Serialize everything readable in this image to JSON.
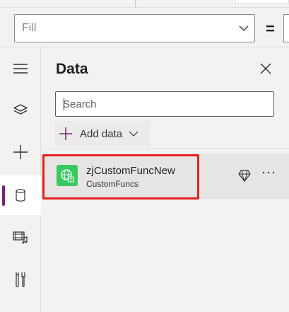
{
  "property_bar": {
    "property_value": "Fill",
    "equals": "="
  },
  "rail": {
    "items": [
      {
        "icon": "hamburger-menu-icon"
      },
      {
        "icon": "layers-icon"
      },
      {
        "icon": "plus-icon"
      },
      {
        "icon": "database-icon",
        "active": true
      },
      {
        "icon": "media-icon"
      },
      {
        "icon": "tools-icon"
      }
    ],
    "accent": "#742774"
  },
  "data_panel": {
    "title": "Data",
    "search_placeholder": "Search",
    "add_data_label": "Add data",
    "sources": [
      {
        "name": "zjCustomFuncNew",
        "subtitle": "CustomFuncs",
        "icon": "globe-connector-icon",
        "icon_color": "#3bc95f"
      }
    ]
  },
  "colors": {
    "highlight": "#e5201c",
    "brand_accent": "#742774"
  }
}
